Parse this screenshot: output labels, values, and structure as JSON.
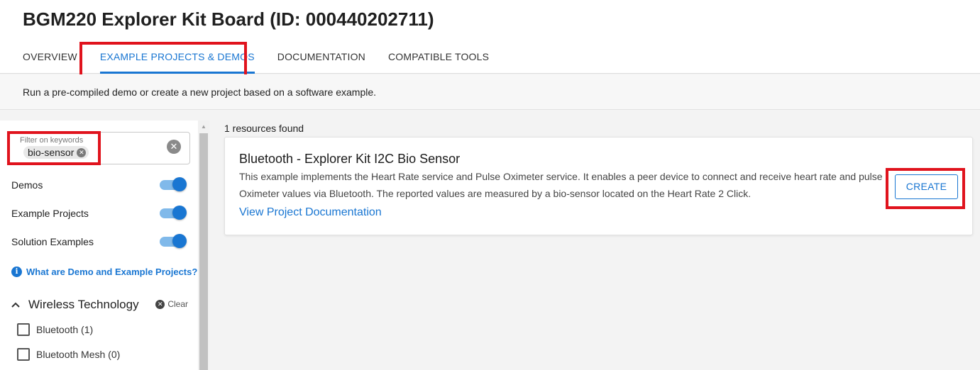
{
  "header": {
    "title": "BGM220 Explorer Kit Board (ID: 000440202711)",
    "tabs": [
      {
        "label": "OVERVIEW",
        "active": false
      },
      {
        "label": "EXAMPLE PROJECTS & DEMOS",
        "active": true
      },
      {
        "label": "DOCUMENTATION",
        "active": false
      },
      {
        "label": "COMPATIBLE TOOLS",
        "active": false
      }
    ]
  },
  "subheader": {
    "text": "Run a pre-compiled demo or create a new project based on a software example."
  },
  "sidebar": {
    "filter": {
      "label": "Filter on keywords",
      "chip": "bio-sensor"
    },
    "toggles": [
      {
        "label": "Demos",
        "on": true
      },
      {
        "label": "Example Projects",
        "on": true
      },
      {
        "label": "Solution Examples",
        "on": true
      }
    ],
    "info_link": "What are Demo and Example Projects?",
    "section": {
      "title": "Wireless Technology",
      "clear_label": "Clear",
      "items": [
        {
          "label": "Bluetooth (1)",
          "checked": false
        },
        {
          "label": "Bluetooth Mesh (0)",
          "checked": false
        }
      ]
    }
  },
  "results": {
    "count_text": "1 resources found",
    "items": [
      {
        "title": "Bluetooth - Explorer Kit I2C Bio Sensor",
        "description": "This example implements the Heart Rate service and Pulse Oximeter service. It enables a peer device to connect and receive heart rate and pulse Oximeter values via Bluetooth. The reported values are measured by a bio-sensor located on the Heart Rate 2 Click.",
        "link": "View Project Documentation",
        "button": "CREATE"
      }
    ]
  },
  "colors": {
    "accent": "#1976d2",
    "highlight": "#e0131d"
  }
}
